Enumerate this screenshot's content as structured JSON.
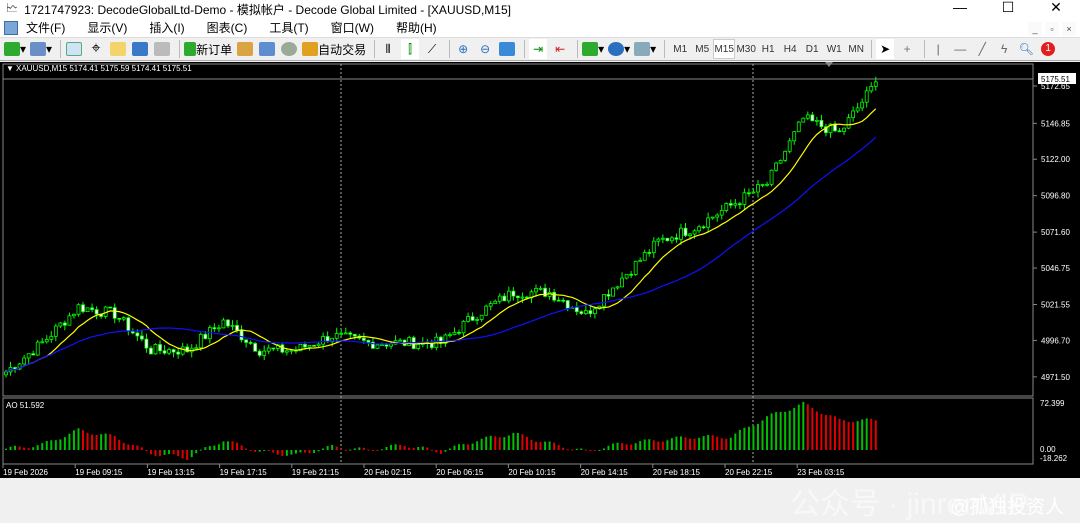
{
  "window": {
    "title": "1721747923: DecodeGlobalLtd-Demo - 模拟帐户 - Decode Global Limited - [XAUUSD,M15]",
    "min": "—",
    "max": "☐",
    "close": "✕"
  },
  "menu": [
    "文件(F)",
    "显示(V)",
    "插入(I)",
    "图表(C)",
    "工具(T)",
    "窗口(W)",
    "帮助(H)"
  ],
  "toolbar": {
    "new_order": "新订单",
    "auto_trade": "自动交易",
    "timeframes": [
      "M1",
      "M5",
      "M15",
      "M30",
      "H1",
      "H4",
      "D1",
      "W1",
      "MN"
    ],
    "active_tf": "M15",
    "notif_count": "1"
  },
  "chart_data": {
    "type": "candlestick",
    "symbol_header": "XAUUSD,M15  5174.41 5175.59 5174.41 5175.51",
    "current_price": "5175.51",
    "price_ticks": [
      "5172.65",
      "5146.85",
      "5122.00",
      "5096.80",
      "5071.60",
      "5046.75",
      "5021.55",
      "4996.70",
      "4971.50"
    ],
    "ylim": [
      4960,
      5185
    ],
    "close_keypoints_every_8_bars": [
      4975,
      4995,
      5020,
      5015,
      4990,
      4990,
      5010,
      4990,
      4990,
      5000,
      4995,
      4995,
      4995,
      5015,
      5030,
      5030,
      5015,
      5040,
      5065,
      5075,
      5090,
      5105,
      5150,
      5140,
      5175
    ],
    "ma_colors": {
      "fast": "#ffff00",
      "slow": "#1010ff"
    },
    "time_labels": [
      "19 Feb 2026",
      "19 Feb 09:15",
      "19 Feb 13:15",
      "19 Feb 17:15",
      "19 Feb 21:15",
      "20 Feb 02:15",
      "20 Feb 06:15",
      "20 Feb 10:15",
      "20 Feb 14:15",
      "20 Feb 18:15",
      "20 Feb 22:15",
      "23 Feb 03:15"
    ],
    "indicator": {
      "label": "AO 51.592",
      "max_label": "72.399",
      "zero_label": "0.00",
      "min_label": "-18.262",
      "ylim": [
        -18.262,
        72.399
      ],
      "keypoints_every_8_bars": [
        2,
        8,
        30,
        20,
        -5,
        -12,
        15,
        -3,
        -8,
        5,
        0,
        8,
        -3,
        15,
        25,
        10,
        -2,
        10,
        15,
        20,
        20,
        50,
        70,
        45,
        45
      ]
    },
    "up_color": "#00ff00",
    "down_color": "#ffffff"
  },
  "watermark": {
    "text": "公众号 · jinrenVIP",
    "author": "@孤独投资人"
  }
}
